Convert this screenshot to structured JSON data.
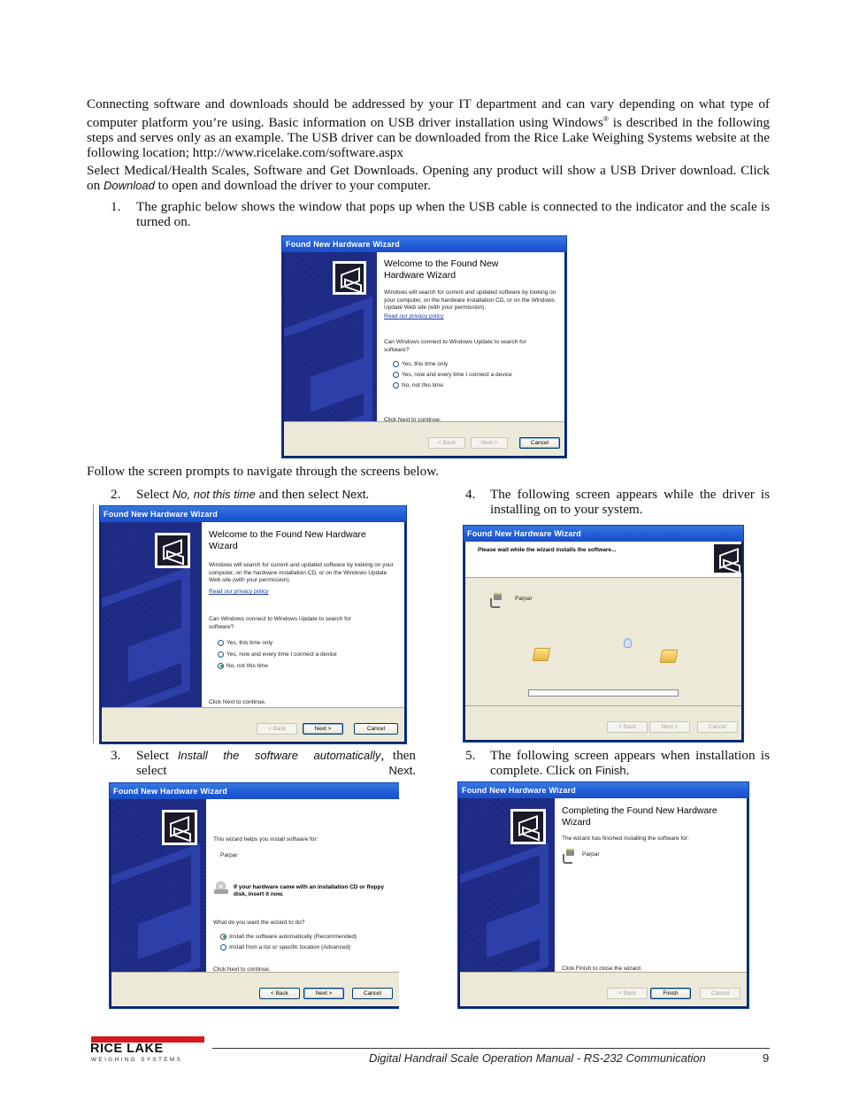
{
  "intro": {
    "para1": "Connecting software and downloads should be addressed by your IT department and can vary depending on what type of computer platform you’re using. Basic information on USB driver installation using Windows",
    "para1_reg": "®",
    "para1_end": " is described in the following steps and serves only as an example. The USB driver can be downloaded from the Rice Lake Weighing Systems website at the following location; http://www.ricelake.com/software.aspx",
    "para2_a": "Select Medical/Health Scales, Software and Get Downloads. Opening any product will show a USB Driver download. Click on ",
    "para2_it": "Download",
    "para2_b": " to open and download the driver to your computer."
  },
  "steps": [
    {
      "num": "1.",
      "text": "The graphic below shows the window that pops up when the USB cable is connected to the indicator and the scale is turned on."
    },
    {
      "num": "2.",
      "a": "Select ",
      "it": "No, not this time",
      "b": " and then select ",
      "bd": "Next",
      "c": "."
    },
    {
      "num": "3.",
      "a": "Select ",
      "it": "Install the software automatically",
      "b": ", then select ",
      "bd": "Next",
      "c": "."
    },
    {
      "num": "4.",
      "text": "The following screen appears while the driver is installing on to your system."
    },
    {
      "num": "5.",
      "a": "The following screen appears when installation is complete. Click on ",
      "bd": "Finish",
      "c": "."
    }
  ],
  "follow_text": "Follow the screen prompts to navigate through the screens below.",
  "wizard": {
    "title": "Found New Hardware Wizard",
    "welcome_heading": "Welcome to the Found New Hardware Wizard",
    "welcome_desc": "Windows will search for current and updated software by looking on your computer, on the hardware installation CD, or on the Windows Update Web site (with your permission).",
    "privacy_link": "Read our privacy policy",
    "update_question": "Can Windows connect to Windows Update to search for software?",
    "radio_options": [
      "Yes, this time only",
      "Yes, now and every time I connect a device",
      "No, not this time"
    ],
    "click_next": "Click Next to continue.",
    "back": "< Back",
    "next": "Next >",
    "cancel": "Cancel",
    "finish": "Finish",
    "install_helps": "This wizard helps you install software for:",
    "device_name": "Parpar",
    "cd_prompt": "If your hardware came with an installation CD or floppy disk, insert it now.",
    "what_do": "What do you want the wizard to do?",
    "install_options": [
      "Install the software automatically (Recommended)",
      "Install from a list or specific location (Advanced)"
    ],
    "please_wait": "Please wait while the wizard installs the software...",
    "progress": 0,
    "completing_heading": "Completing the Found New Hardware Wizard",
    "finished_text": "The wizard has finished installing the software for:",
    "click_finish": "Click Finish to close the wizard."
  },
  "footer": {
    "logo": "RICE LAKE",
    "logo_sub": "WEIGHING SYSTEMS",
    "manual_title": "Digital Handrail Scale Operation Manual - RS-232 Communication",
    "page_number": "9"
  },
  "colors": {
    "logo_red": "#d71920",
    "titlebar_blue": "#1f5ad6",
    "side_panel": "#1c2a8a",
    "footer_bg": "#ece9d8"
  }
}
